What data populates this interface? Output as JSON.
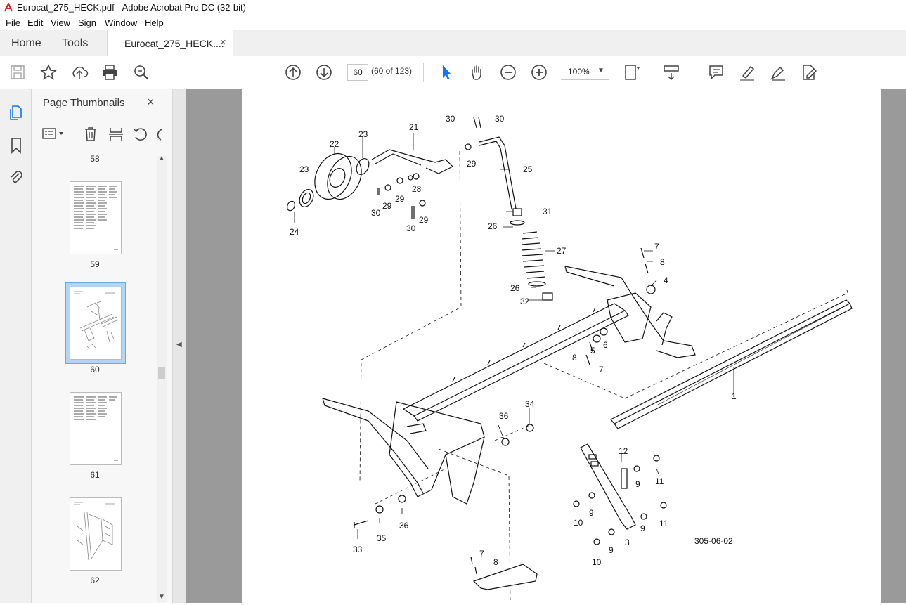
{
  "window": {
    "title": "Eurocat_275_HECK.pdf - Adobe Acrobat Pro DC (32-bit)"
  },
  "menu": [
    "File",
    "Edit",
    "View",
    "Sign",
    "Window",
    "Help"
  ],
  "tabs": {
    "home": "Home",
    "tools": "Tools",
    "document": "Eurocat_275_HECK....",
    "close": "×"
  },
  "toolbar": {
    "page_number": "60",
    "page_count": "(60 of 123)",
    "zoom": "100%",
    "icons": [
      "save-icon",
      "star-icon",
      "upload-icon",
      "print-icon",
      "zoom-search-icon",
      "page-up-icon",
      "page-down-icon",
      "select-arrow-icon",
      "hand-icon",
      "zoom-out-icon",
      "zoom-in-icon",
      "fit-page-icon",
      "scroll-mode-icon",
      "comment-icon",
      "highlight-icon",
      "sign-icon",
      "fill-sign-icon"
    ]
  },
  "sidebar": {
    "panel_title": "Page Thumbnails",
    "close": "×",
    "thumbnails": [
      {
        "label": "58",
        "selected": false
      },
      {
        "label": "59",
        "selected": false
      },
      {
        "label": "60",
        "selected": true
      },
      {
        "label": "61",
        "selected": false
      },
      {
        "label": "62",
        "selected": false
      }
    ]
  },
  "drawing": {
    "callouts": [
      "1",
      "3",
      "4",
      "5",
      "6",
      "7",
      "8",
      "9",
      "10",
      "11",
      "12",
      "21",
      "22",
      "23",
      "24",
      "25",
      "26",
      "27",
      "28",
      "29",
      "30",
      "31",
      "32",
      "33",
      "34",
      "35",
      "36"
    ],
    "figure_code": "305-06-02"
  },
  "colors": {
    "accent": "#1473e6",
    "selected_thumb": "#b6d4f2"
  }
}
